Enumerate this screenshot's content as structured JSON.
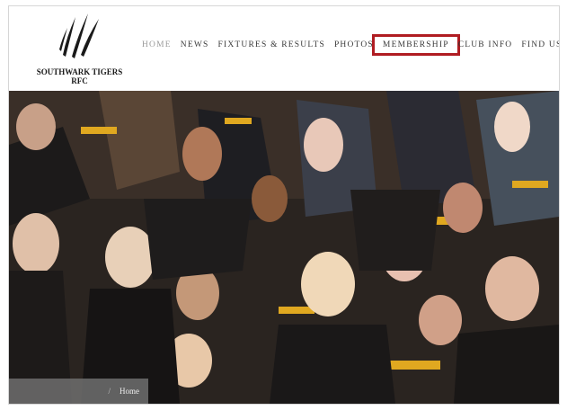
{
  "logo": {
    "name_line1": "SOUTHWARK TIGERS",
    "name_line2": "RFC",
    "icon": "claw-marks-icon"
  },
  "nav": {
    "items": [
      {
        "label": "HOME"
      },
      {
        "label": "NEWS"
      },
      {
        "label": "FIXTURES & RESULTS"
      },
      {
        "label": "PHOTOS"
      },
      {
        "label": "MEMBERSHIP"
      },
      {
        "label": "CLUB INFO"
      },
      {
        "label": "FIND US"
      }
    ],
    "active": "HOME",
    "highlighted": "MEMBERSHIP",
    "highlight_color": "#b01c22"
  },
  "breadcrumb": {
    "separator": "/",
    "current": "Home"
  },
  "colors": {
    "text": "#3a3a3a",
    "active": "#9a9a9a",
    "hero_dark": "#2a2420",
    "tiger_yellow": "#e0a820"
  }
}
